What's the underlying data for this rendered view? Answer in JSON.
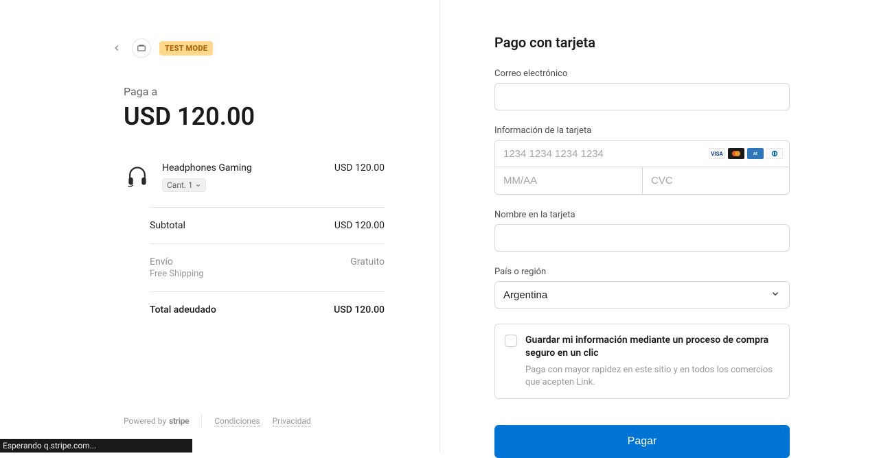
{
  "header": {
    "test_mode_label": "TEST MODE"
  },
  "summary": {
    "pay_to_label": "Paga a",
    "amount": "USD 120.00",
    "product": {
      "name": "Headphones Gaming",
      "qty_label": "Cant. 1",
      "price": "USD 120.00"
    },
    "subtotal_label": "Subtotal",
    "subtotal_value": "USD 120.00",
    "shipping_label": "Envío",
    "shipping_sub": "Free Shipping",
    "shipping_value": "Gratuito",
    "total_label": "Total adeudado",
    "total_value": "USD 120.00"
  },
  "footer": {
    "powered_by": "Powered by",
    "brand": "stripe",
    "terms": "Condiciones",
    "privacy": "Privacidad"
  },
  "payment": {
    "title": "Pago con tarjeta",
    "email_label": "Correo electrónico",
    "card_label": "Información de la tarjeta",
    "card_number_placeholder": "1234 1234 1234 1234",
    "card_exp_placeholder": "MM/AA",
    "card_cvc_placeholder": "CVC",
    "name_label": "Nombre en la tarjeta",
    "country_label": "País o región",
    "country_value": "Argentina",
    "save_main": "Guardar mi información mediante un proceso de compra seguro en un clic",
    "save_sub": "Paga con mayor rapidez en este sitio y en todos los comercios que acepten Link.",
    "pay_button": "Pagar"
  },
  "status_bar": "Esperando q.stripe.com..."
}
